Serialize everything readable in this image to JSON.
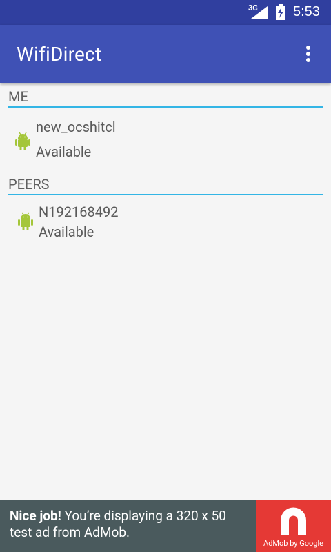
{
  "status_bar": {
    "network_type": "3G",
    "time": "5:53",
    "icons": [
      "signal-icon",
      "battery-icon"
    ]
  },
  "app_bar": {
    "title": "WifiDirect",
    "menu_icon": "overflow-menu-icon"
  },
  "sections": {
    "me": {
      "header": "ME",
      "device": {
        "name": "new_ocshitcl",
        "status": "Available",
        "icon": "android-icon"
      }
    },
    "peers": {
      "header": "PEERS",
      "devices": [
        {
          "name": "N192168492",
          "status": "Available",
          "icon": "android-icon"
        }
      ]
    }
  },
  "ad_banner": {
    "headline": "Nice job!",
    "body": " You’re displaying a 320 x 50 test ad from AdMob.",
    "logo_caption": "AdMob by Google",
    "logo_icon": "admob-logo-icon"
  },
  "colors": {
    "status_bar": "#303f9f",
    "app_bar": "#3f51b5",
    "background": "#f5f5f5",
    "divider": "#33b5e5",
    "android_green": "#a4c639",
    "ad_background": "#4a5a5d",
    "ad_logo_background": "#e53935"
  }
}
